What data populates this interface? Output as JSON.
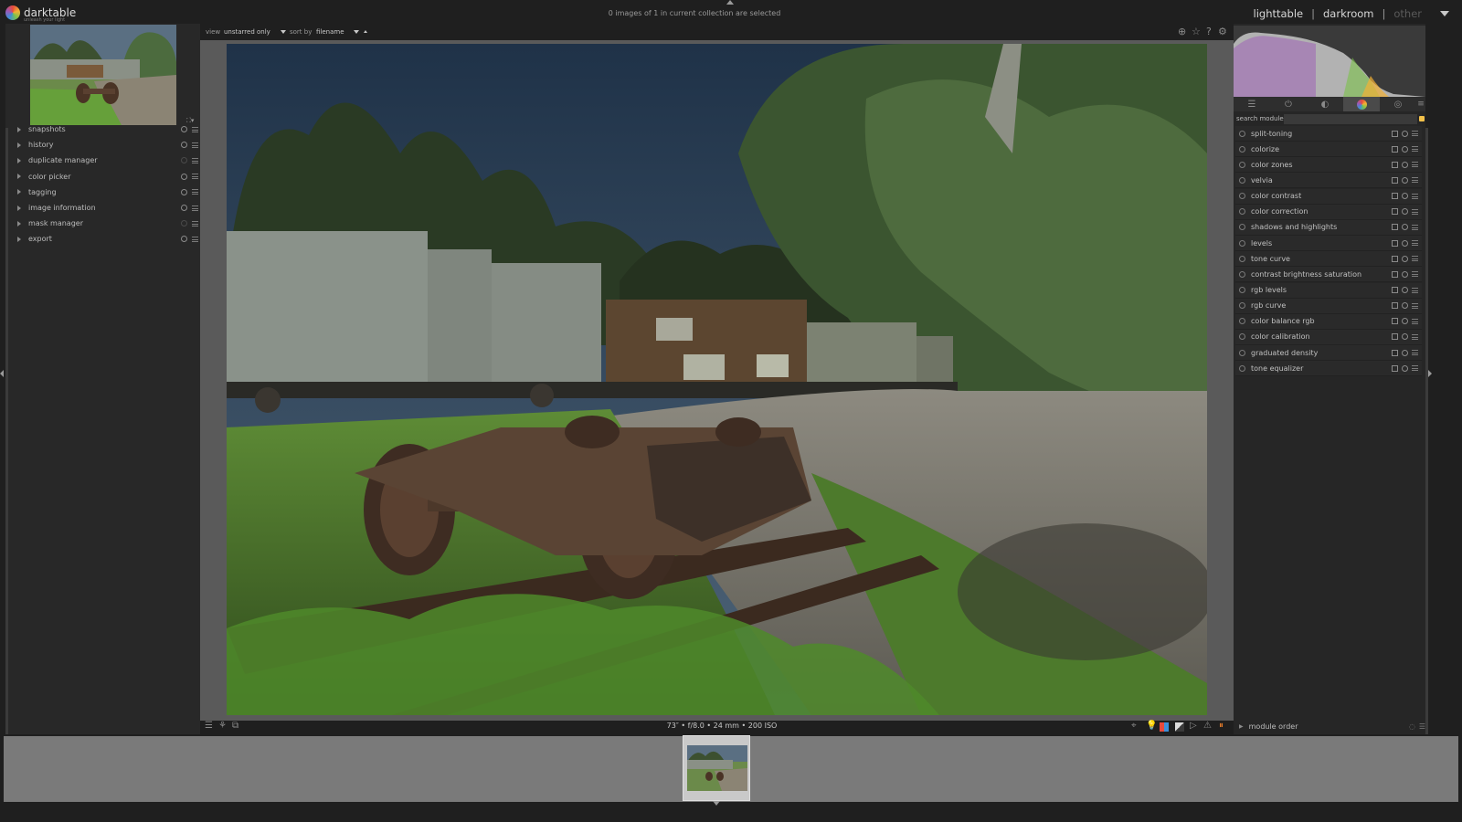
{
  "app": {
    "name": "darktable",
    "tagline": "unleash your light"
  },
  "status": {
    "selection": "0 images of 1 in current collection are selected"
  },
  "views": {
    "lighttable": "lighttable",
    "separator": "|",
    "darkroom": "darkroom",
    "other": "other"
  },
  "toolbar": {
    "view_label": "view",
    "view_value": "unstarred only",
    "sort_label": "sort by",
    "sort_value": "filename"
  },
  "left_modules": [
    {
      "label": "snapshots",
      "icon_dim": false
    },
    {
      "label": "history",
      "icon_dim": false
    },
    {
      "label": "duplicate manager",
      "icon_dim": true
    },
    {
      "label": "color picker",
      "icon_dim": false
    },
    {
      "label": "tagging",
      "icon_dim": false
    },
    {
      "label": "image information",
      "icon_dim": false
    },
    {
      "label": "mask manager",
      "icon_dim": true
    },
    {
      "label": "export",
      "icon_dim": false
    }
  ],
  "right": {
    "search_label": "search module",
    "search_value": "",
    "modules": [
      "split-toning",
      "colorize",
      "color zones",
      "velvia",
      "color contrast",
      "color correction",
      "shadows and highlights",
      "levels",
      "tone curve",
      "contrast brightness saturation",
      "rgb levels",
      "rgb curve",
      "color balance rgb",
      "color calibration",
      "graduated density",
      "tone equalizer"
    ],
    "module_order": "module order",
    "active_tab": 3
  },
  "exif": "73″ • f/8.0 • 24 mm • 200 ISO",
  "colors": {
    "accent": "#f2c14a",
    "panel": "#282828",
    "center": "#5a5a5a",
    "warning": "#e07a2a"
  }
}
